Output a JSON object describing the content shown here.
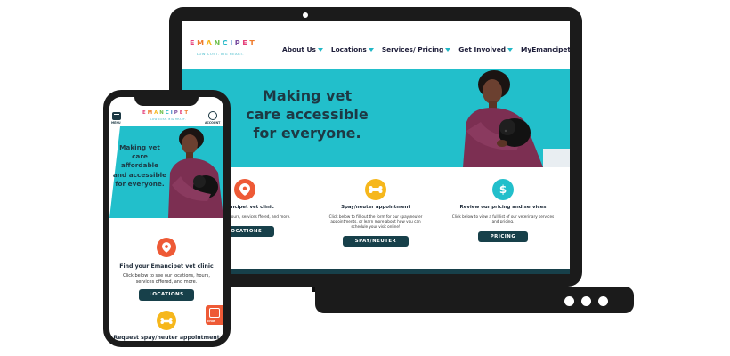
{
  "brand": {
    "letters": [
      "E",
      "M",
      "A",
      "N",
      "C",
      "I",
      "P",
      "E",
      "T"
    ],
    "letter_colors": [
      "#e5417a",
      "#ef7b2c",
      "#f6b71c",
      "#6cbf4a",
      "#21b7c6",
      "#3b82c4",
      "#7a4ea0",
      "#e5417a",
      "#ef7b2c"
    ],
    "tagline": "LOW COST. BIG HEART."
  },
  "colors": {
    "teal": "#22bfcb",
    "dark_teal": "#17404a",
    "orange": "#ee5a36",
    "yellow": "#f6b71c"
  },
  "desktop": {
    "nav": [
      {
        "label": "About Us"
      },
      {
        "label": "Locations"
      },
      {
        "label": "Services/ Pricing"
      },
      {
        "label": "Get Involved"
      },
      {
        "label": "MyEmancipet"
      }
    ],
    "hero_title_lines": [
      "Making vet",
      "care accessible",
      "for everyone."
    ],
    "cards": [
      {
        "icon": "location-pin-icon",
        "title": "r Emancipet vet clinic",
        "desc": "e our locations, hours, services ffered, and more.",
        "button": "LOCATIONS"
      },
      {
        "icon": "bone-icon",
        "title": "Spay/neuter appointment",
        "desc": "Click below to fill out the form for our spay/neuter appointments, or learn more about how you can schedule your visit online!",
        "button": "SPAY/NEUTER"
      },
      {
        "icon": "dollar-icon",
        "title": "Review our pricing and services",
        "desc": "Click below to view a full list of our veterinary services and pricing.",
        "button": "PRICING"
      }
    ]
  },
  "mobile": {
    "menu_label": "MENU",
    "account_label": "ACCOUNT",
    "hero_title_lines": [
      "Making vet",
      "care affordable",
      "and accessible",
      "for everyone."
    ],
    "clinic": {
      "title": "Find your Emancipet vet clinic",
      "desc": "Click below to see our locations, hours, services offered, and more.",
      "button": "LOCATIONS"
    },
    "spay_title": "Request spay/neuter appointment",
    "chat_label": "CHAT"
  }
}
